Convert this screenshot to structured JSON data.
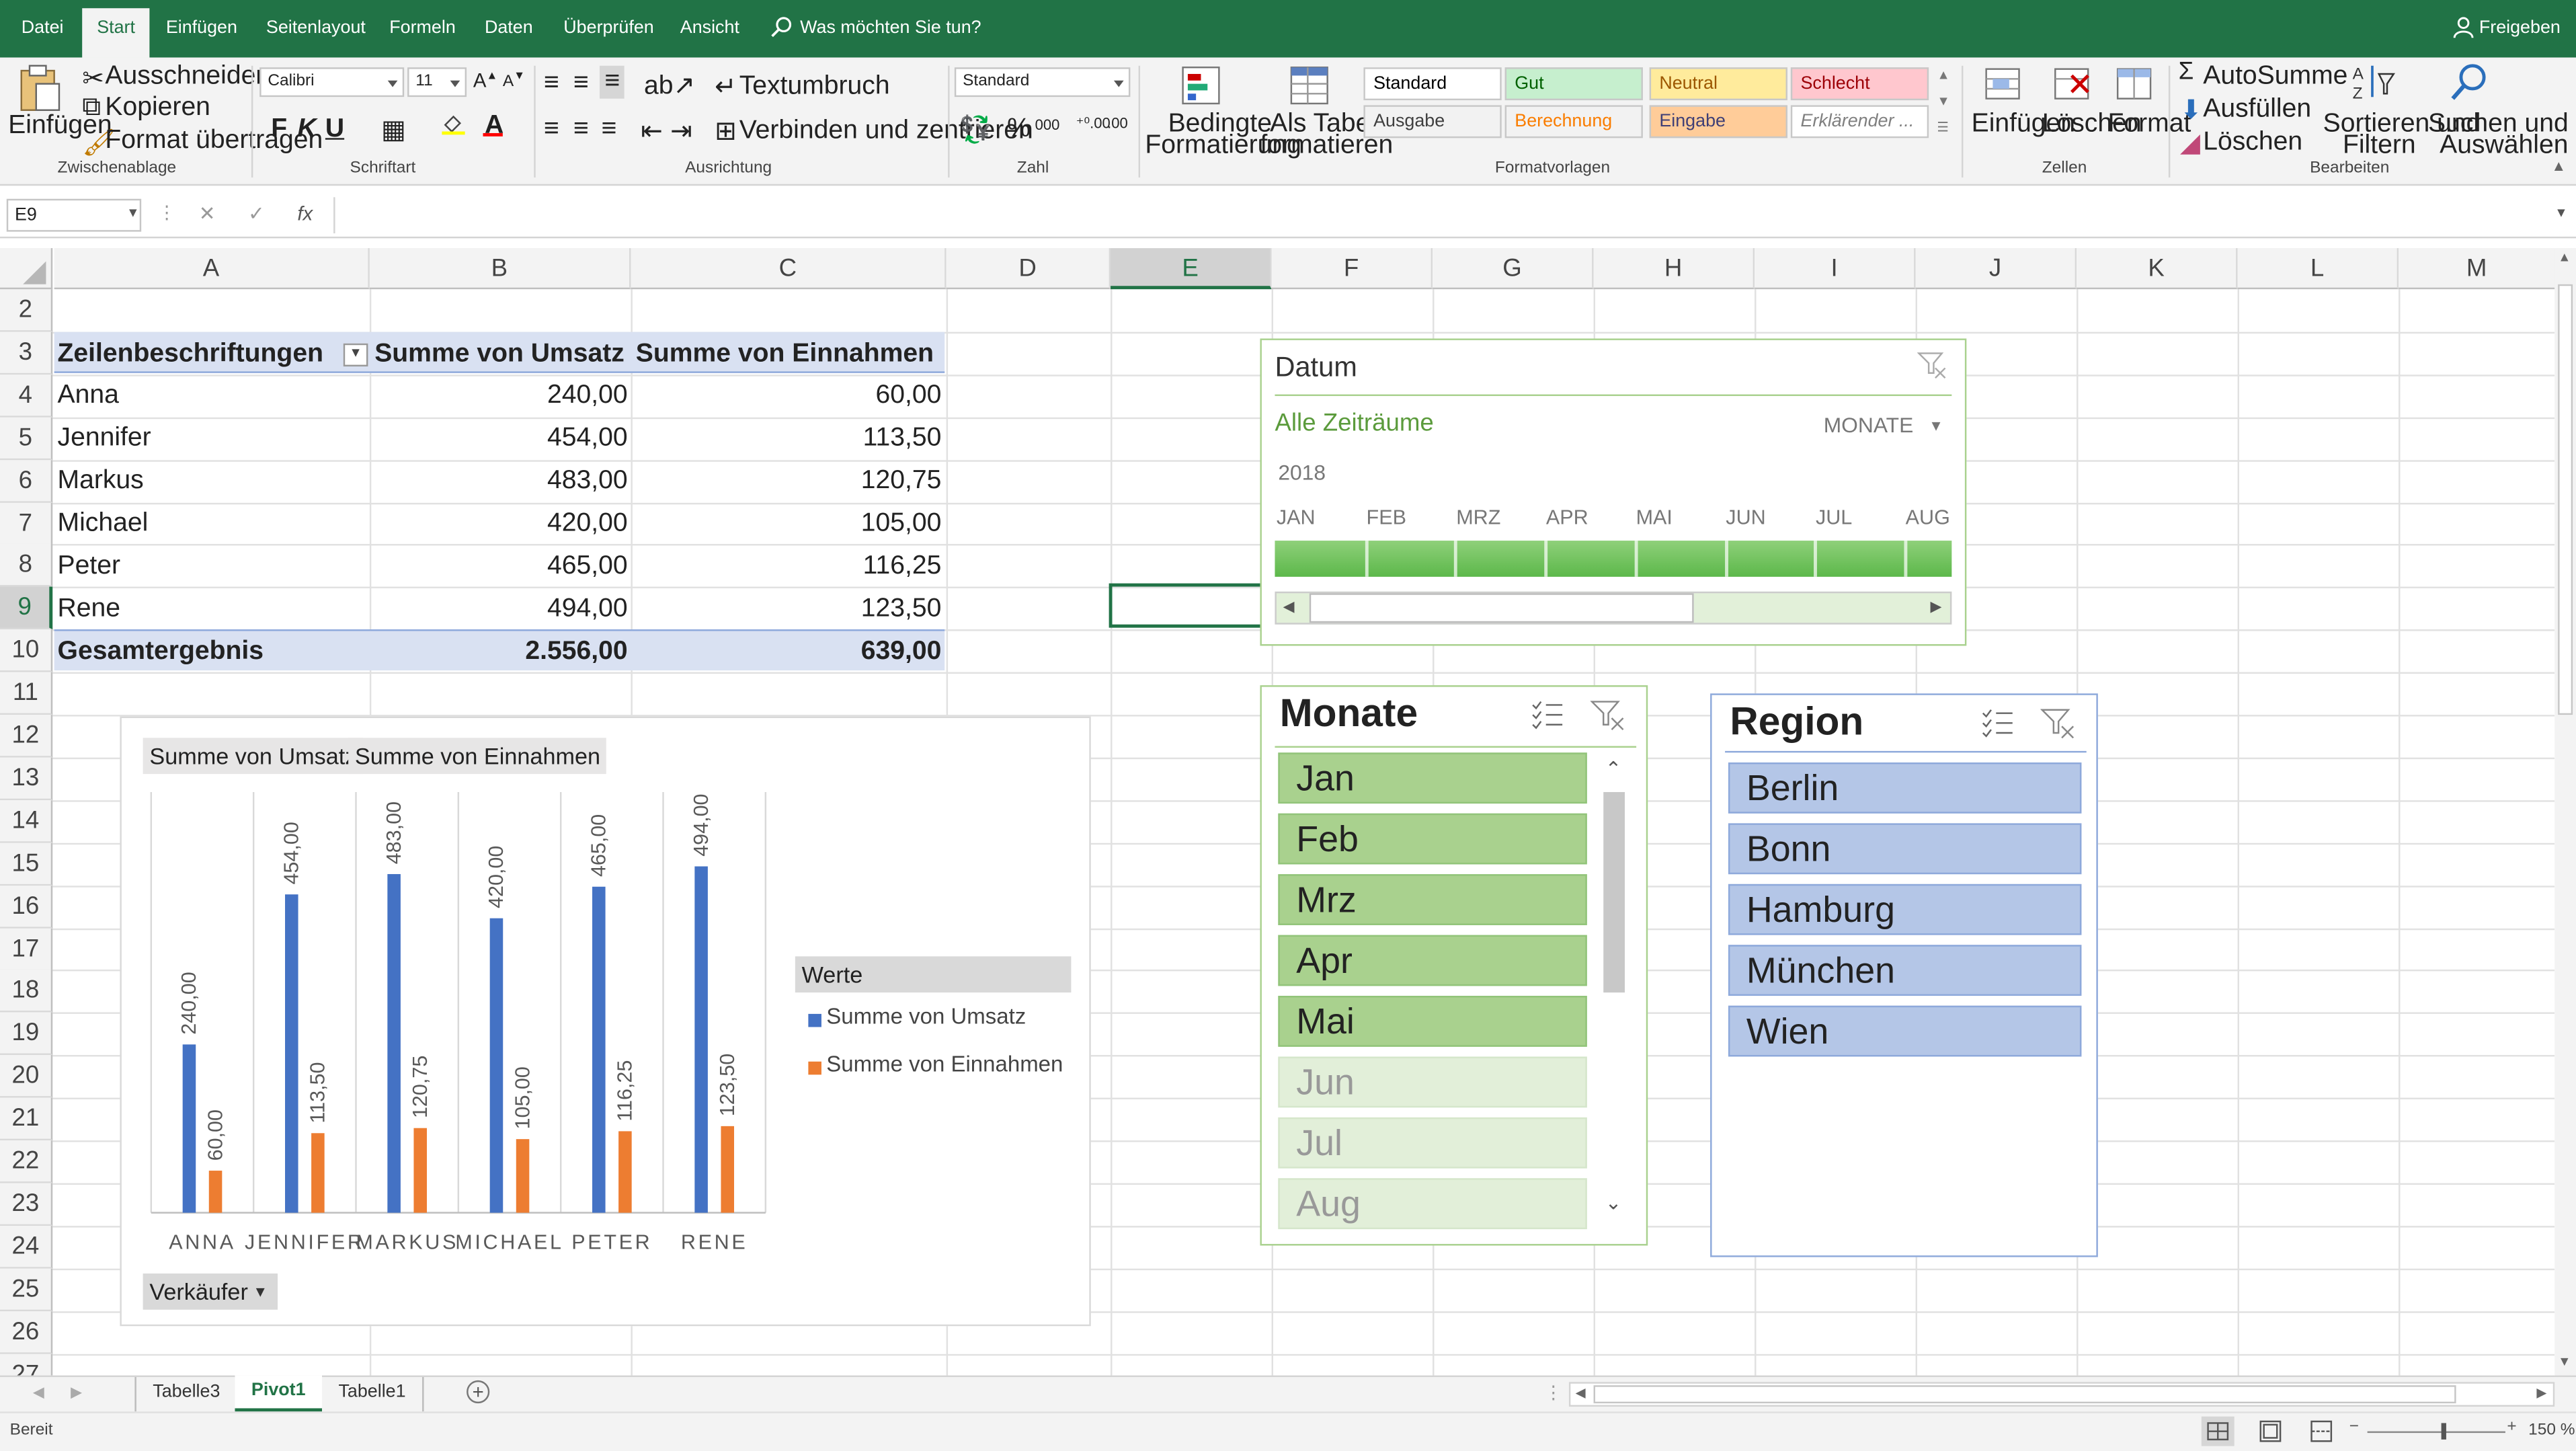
{
  "menu": {
    "tabs": [
      "Datei",
      "Start",
      "Einfügen",
      "Seitenlayout",
      "Formeln",
      "Daten",
      "Überprüfen",
      "Ansicht"
    ],
    "tell_me": "Was möchten Sie tun?",
    "share": "Freigeben"
  },
  "ribbon": {
    "clipboard": {
      "paste": "Einfügen",
      "cut": "Ausschneiden",
      "copy": "Kopieren",
      "format_painter": "Format übertragen",
      "label": "Zwischenablage"
    },
    "font": {
      "name": "Calibri",
      "size": "11",
      "bold": "F",
      "italic": "K",
      "underline": "U",
      "label": "Schriftart"
    },
    "alignment": {
      "wrap": "Textumbruch",
      "merge": "Verbinden und zentrieren",
      "label": "Ausrichtung"
    },
    "number": {
      "format": "Standard",
      "percent": "%",
      "thousands": "000",
      "label": "Zahl"
    },
    "styles": {
      "conditional": [
        "Bedingte",
        "Formatierung"
      ],
      "as_table": [
        "Als Tabelle",
        "formatieren"
      ],
      "cells": [
        {
          "text": "Standard",
          "bg": "#ffffff",
          "fg": "#000000"
        },
        {
          "text": "Gut",
          "bg": "#c6efce",
          "fg": "#006100"
        },
        {
          "text": "Neutral",
          "bg": "#ffeb9c",
          "fg": "#9c5700"
        },
        {
          "text": "Schlecht",
          "bg": "#ffc7ce",
          "fg": "#9c0006"
        },
        {
          "text": "Ausgabe",
          "bg": "#f2f2f2",
          "fg": "#3f3f3f"
        },
        {
          "text": "Berechnung",
          "bg": "#f2f2f2",
          "fg": "#fa7d00"
        },
        {
          "text": "Eingabe",
          "bg": "#ffcc99",
          "fg": "#3f3f76"
        },
        {
          "text": "Erklärender ...",
          "bg": "#ffffff",
          "fg": "#7f7f7f"
        }
      ],
      "label": "Formatvorlagen"
    },
    "cells_group": {
      "insert": "Einfügen",
      "delete": "Löschen",
      "format": "Format",
      "label": "Zellen"
    },
    "editing": {
      "autosum": "AutoSumme",
      "fill": "Ausfüllen",
      "clear": "Löschen",
      "sort": [
        "Sortieren und",
        "Filtern"
      ],
      "find": [
        "Suchen und",
        "Auswählen"
      ],
      "label": "Bearbeiten"
    }
  },
  "formula_bar": {
    "name_box": "E9",
    "cancel": "✕",
    "enter": "✓",
    "fx": "fx",
    "content": ""
  },
  "sheet": {
    "columns": [
      "A",
      "B",
      "C",
      "D",
      "E",
      "F",
      "G",
      "H",
      "I",
      "J",
      "K",
      "L",
      "M"
    ],
    "rows": [
      "2",
      "3",
      "4",
      "5",
      "6",
      "7",
      "8",
      "9",
      "10",
      "11",
      "12",
      "13",
      "14",
      "15",
      "16",
      "17",
      "18",
      "19",
      "20",
      "21",
      "22",
      "23",
      "24",
      "25",
      "26",
      "27"
    ],
    "selected_cell": "E9",
    "pivot": {
      "headers": [
        "Zeilenbeschriftungen",
        "Summe von Umsatz",
        "Summe von Einnahmen"
      ],
      "rows": [
        [
          "Anna",
          "240,00",
          "60,00"
        ],
        [
          "Jennifer",
          "454,00",
          "113,50"
        ],
        [
          "Markus",
          "483,00",
          "120,75"
        ],
        [
          "Michael",
          "420,00",
          "105,00"
        ],
        [
          "Peter",
          "465,00",
          "116,25"
        ],
        [
          "Rene",
          "494,00",
          "123,50"
        ]
      ],
      "total": [
        "Gesamtergebnis",
        "2.556,00",
        "639,00"
      ]
    }
  },
  "chart_field_buttons": [
    "Summe von Umsatz",
    "Summe von Einnahmen"
  ],
  "chart_axis_button": "Verkäufer",
  "chart_data": {
    "type": "bar",
    "categories": [
      "ANNA",
      "JENNIFER",
      "MARKUS",
      "MICHAEL",
      "PETER",
      "RENE"
    ],
    "series": [
      {
        "name": "Summe von Umsatz",
        "values": [
          240,
          454,
          483,
          420,
          465,
          494
        ],
        "labels": [
          "240,00",
          "454,00",
          "483,00",
          "420,00",
          "465,00",
          "494,00"
        ],
        "color": "#4472c4"
      },
      {
        "name": "Summe von Einnahmen",
        "values": [
          60,
          113.5,
          120.75,
          105,
          116.25,
          123.5
        ],
        "labels": [
          "60,00",
          "113,50",
          "120,75",
          "105,00",
          "116,25",
          "123,50"
        ],
        "color": "#ed7d31"
      }
    ],
    "legend_title": "Werte",
    "legend_position": "right",
    "ylim": [
      0,
      600
    ],
    "grid": true
  },
  "timeline": {
    "title": "Datum",
    "all_periods": "Alle Zeiträume",
    "level": "MONATE",
    "year": "2018",
    "months": [
      "JAN",
      "FEB",
      "MRZ",
      "APR",
      "MAI",
      "JUN",
      "JUL",
      "AUG"
    ]
  },
  "slicer_months": {
    "title": "Monate",
    "items": [
      "Jan",
      "Feb",
      "Mrz",
      "Apr",
      "Mai",
      "Jun",
      "Jul",
      "Aug"
    ],
    "active_count": 5
  },
  "slicer_region": {
    "title": "Region",
    "items": [
      "Berlin",
      "Bonn",
      "Hamburg",
      "München",
      "Wien"
    ]
  },
  "tabs": {
    "sheets": [
      "Tabelle3",
      "Pivot1",
      "Tabelle1"
    ],
    "active": "Pivot1",
    "add": "+"
  },
  "status": {
    "ready": "Bereit",
    "zoom": "150 %"
  }
}
